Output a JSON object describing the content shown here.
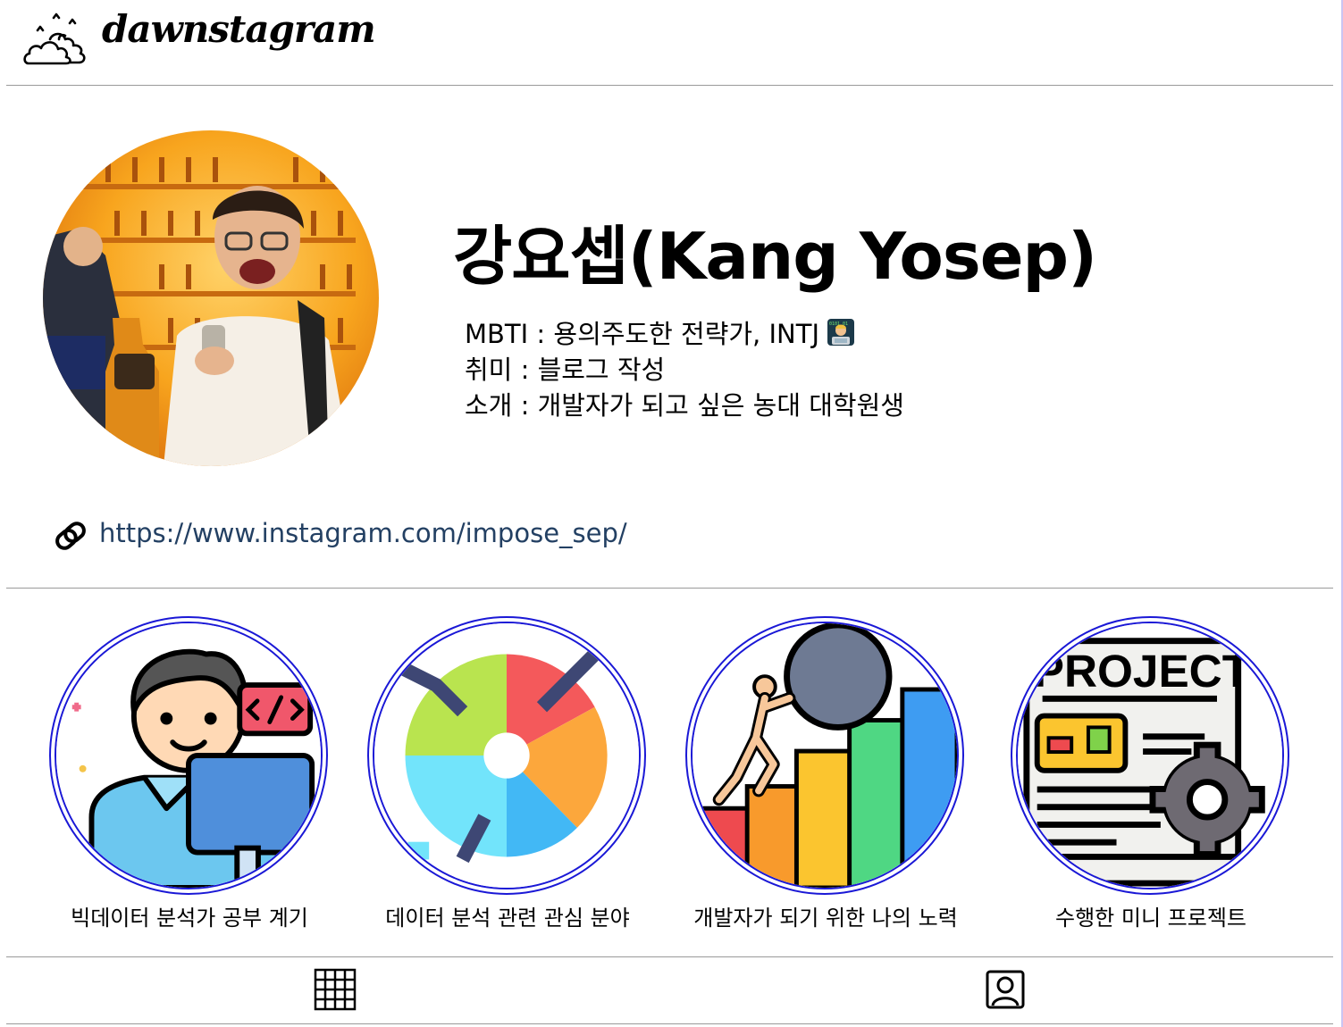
{
  "header": {
    "brand": "dawnstagram",
    "logo_icon": "cloud-icon"
  },
  "profile": {
    "name": "강요셉(Kang Yosep)",
    "avatar_icon": "profile-photo",
    "info": [
      "MBTI : 용의주도한 전략가, INTJ",
      "취미 : 블로그 작성",
      "소개 : 개발자가 되고 싶은 농대 대학원생"
    ],
    "mbti_emoji": "technologist-emoji",
    "link_icon": "link-icon",
    "link_url": "https://www.instagram.com/impose_sep/"
  },
  "highlights": [
    {
      "label": "빅데이터 분석가 공부 계기",
      "icon": "developer-icon"
    },
    {
      "label": "데이터 분석 관련 관심 분야",
      "icon": "pie-chart-icon"
    },
    {
      "label": "개발자가 되기 위한 나의 노력",
      "icon": "growth-chart-icon"
    },
    {
      "label": "수행한 미니 프로젝트",
      "icon": "project-document-icon"
    }
  ],
  "highlight_texts": {
    "project_word": "PROJECT"
  },
  "tabs": [
    {
      "name": "grid",
      "icon": "grid-icon"
    },
    {
      "name": "tagged",
      "icon": "person-tag-icon"
    }
  ],
  "colors": {
    "link": "#234063",
    "highlight_ring": "#1a18d6",
    "divider": "#9a9a9a"
  }
}
